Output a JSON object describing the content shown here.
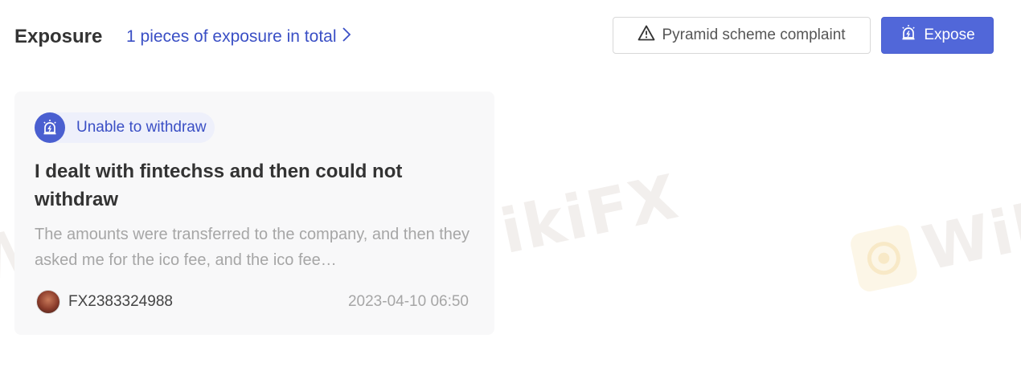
{
  "header": {
    "title": "Exposure",
    "count_link": "1 pieces of exposure in total",
    "complaint_button": "Pyramid scheme complaint",
    "expose_button": "Expose"
  },
  "watermark": {
    "text": "WikiFX",
    "text_partial": "Wiki"
  },
  "cards": [
    {
      "tag": "Unable to withdraw",
      "title": "I dealt with fintechss and then could not withdraw",
      "description": "The amounts were transferred to the company, and then they asked me for the ico fee, and the ico fee…",
      "user": "FX2383324988",
      "date": "2023-04-10 06:50"
    }
  ],
  "colors": {
    "accent": "#5167d9",
    "link": "#3a4fc5",
    "card_bg": "#f8f8f9"
  },
  "icons": [
    "warning-icon",
    "siren-icon",
    "chevron-right-icon",
    "avatar"
  ]
}
